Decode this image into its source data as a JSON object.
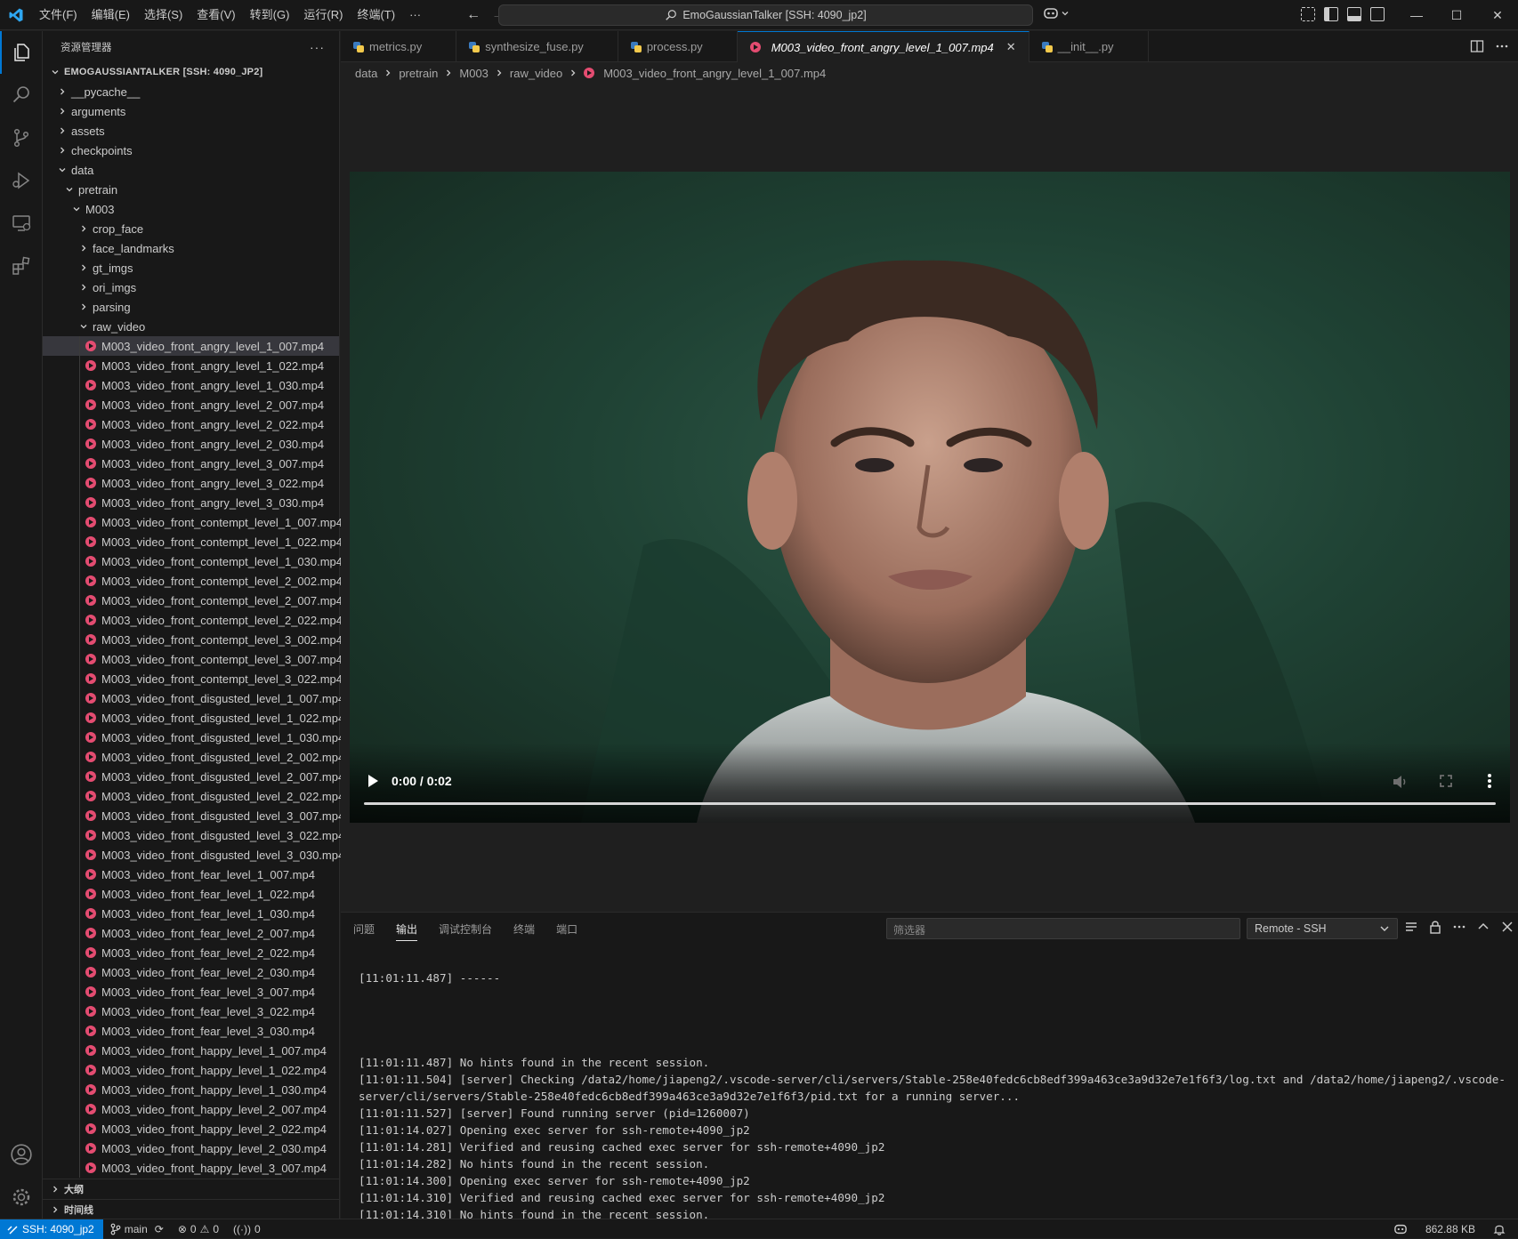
{
  "titlebar": {
    "menus": [
      "文件(F)",
      "编辑(E)",
      "选择(S)",
      "查看(V)",
      "转到(G)",
      "运行(R)",
      "终端(T)",
      "···"
    ],
    "command_center": "EmoGaussianTalker [SSH: 4090_jp2]"
  },
  "explorer": {
    "title": "资源管理器",
    "root": "EMOGAUSSIANTALKER [SSH: 4090_JP2]",
    "folders_top": [
      "__pycache__",
      "arguments",
      "assets",
      "checkpoints"
    ],
    "data": "data",
    "pretrain": "pretrain",
    "m003": "M003",
    "m003_folders": [
      "crop_face",
      "face_landmarks",
      "gt_imgs",
      "ori_imgs",
      "parsing"
    ],
    "raw_video": "raw_video",
    "files": [
      "M003_video_front_angry_level_1_007.mp4",
      "M003_video_front_angry_level_1_022.mp4",
      "M003_video_front_angry_level_1_030.mp4",
      "M003_video_front_angry_level_2_007.mp4",
      "M003_video_front_angry_level_2_022.mp4",
      "M003_video_front_angry_level_2_030.mp4",
      "M003_video_front_angry_level_3_007.mp4",
      "M003_video_front_angry_level_3_022.mp4",
      "M003_video_front_angry_level_3_030.mp4",
      "M003_video_front_contempt_level_1_007.mp4",
      "M003_video_front_contempt_level_1_022.mp4",
      "M003_video_front_contempt_level_1_030.mp4",
      "M003_video_front_contempt_level_2_002.mp4",
      "M003_video_front_contempt_level_2_007.mp4",
      "M003_video_front_contempt_level_2_022.mp4",
      "M003_video_front_contempt_level_3_002.mp4",
      "M003_video_front_contempt_level_3_007.mp4",
      "M003_video_front_contempt_level_3_022.mp4",
      "M003_video_front_disgusted_level_1_007.mp4",
      "M003_video_front_disgusted_level_1_022.mp4",
      "M003_video_front_disgusted_level_1_030.mp4",
      "M003_video_front_disgusted_level_2_002.mp4",
      "M003_video_front_disgusted_level_2_007.mp4",
      "M003_video_front_disgusted_level_2_022.mp4",
      "M003_video_front_disgusted_level_3_007.mp4",
      "M003_video_front_disgusted_level_3_022.mp4",
      "M003_video_front_disgusted_level_3_030.mp4",
      "M003_video_front_fear_level_1_007.mp4",
      "M003_video_front_fear_level_1_022.mp4",
      "M003_video_front_fear_level_1_030.mp4",
      "M003_video_front_fear_level_2_007.mp4",
      "M003_video_front_fear_level_2_022.mp4",
      "M003_video_front_fear_level_2_030.mp4",
      "M003_video_front_fear_level_3_007.mp4",
      "M003_video_front_fear_level_3_022.mp4",
      "M003_video_front_fear_level_3_030.mp4",
      "M003_video_front_happy_level_1_007.mp4",
      "M003_video_front_happy_level_1_022.mp4",
      "M003_video_front_happy_level_1_030.mp4",
      "M003_video_front_happy_level_2_007.mp4",
      "M003_video_front_happy_level_2_022.mp4",
      "M003_video_front_happy_level_2_030.mp4",
      "M003_video_front_happy_level_3_007.mp4"
    ],
    "outline": "大纲",
    "timeline": "时间线"
  },
  "tabs": [
    {
      "label": "metrics.py",
      "icon": "python-file-icon"
    },
    {
      "label": "synthesize_fuse.py",
      "icon": "python-file-icon"
    },
    {
      "label": "process.py",
      "icon": "python-file-icon"
    },
    {
      "label": "M003_video_front_angry_level_1_007.mp4",
      "icon": "video-file-icon",
      "active": true
    },
    {
      "label": "__init__.py",
      "icon": "python-file-icon"
    }
  ],
  "breadcrumb": [
    "data",
    "pretrain",
    "M003",
    "raw_video",
    "M003_video_front_angry_level_1_007.mp4"
  ],
  "video": {
    "time": "0:00 / 0:02",
    "progress": 0.0
  },
  "panel": {
    "tabs": [
      "问题",
      "输出",
      "调试控制台",
      "终端",
      "端口"
    ],
    "active_tab": "输出",
    "filter_placeholder": "筛选器",
    "channel": "Remote - SSH",
    "lines": [
      "[11:01:11.487] ------",
      "",
      "",
      "",
      "",
      "[11:01:11.487] No hints found in the recent session.",
      "[11:01:11.504] [server] Checking /data2/home/jiapeng2/.vscode-server/cli/servers/Stable-258e40fedc6cb8edf399a463ce3a9d32e7e1f6f3/log.txt and /data2/home/jiapeng2/.vscode-server/cli/servers/Stable-258e40fedc6cb8edf399a463ce3a9d32e7e1f6f3/pid.txt for a running server...",
      "[11:01:11.527] [server] Found running server (pid=1260007)",
      "[11:01:14.027] Opening exec server for ssh-remote+4090_jp2",
      "[11:01:14.281] Verified and reusing cached exec server for ssh-remote+4090_jp2",
      "[11:01:14.282] No hints found in the recent session.",
      "[11:01:14.300] Opening exec server for ssh-remote+4090_jp2",
      "[11:01:14.310] Verified and reusing cached exec server for ssh-remote+4090_jp2",
      "[11:01:14.310] No hints found in the recent session."
    ]
  },
  "statusbar": {
    "remote": "SSH: 4090_jp2",
    "branch": "main",
    "errors": "0",
    "warnings": "0",
    "ports": "0",
    "file_size": "862.88 KB"
  },
  "colors": {
    "accent": "#0078d4",
    "video_icon": "#e44c71",
    "bg": "#1f1f1f",
    "sidebar": "#181818"
  }
}
